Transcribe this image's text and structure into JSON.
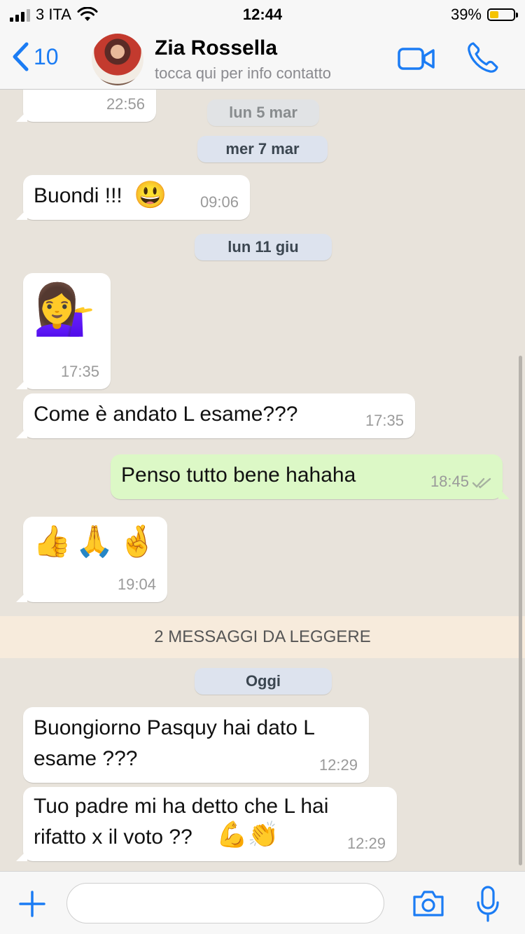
{
  "status_bar": {
    "carrier": "3 ITA",
    "time": "12:44",
    "battery": "39%",
    "battery_level": 0.39,
    "battery_color": "#f5c300"
  },
  "header": {
    "back_count": "10",
    "contact_name": "Zia Rossella",
    "contact_subtitle": "tocca qui per info contatto",
    "accent_color": "#1b7cf4",
    "icons": [
      "chevron-left-icon",
      "video-camera-icon",
      "phone-icon"
    ]
  },
  "chat": {
    "dates": {
      "lun5mar": "lun 5 mar",
      "mer7mar": "mer 7 mar",
      "lun11giu": "lun 11 giu",
      "oggi": "Oggi"
    },
    "messages": [
      {
        "direction": "in",
        "text": "",
        "time": "22:56"
      },
      {
        "direction": "in",
        "text": "Buondi !!!",
        "emoji": "😃",
        "time": "09:06"
      },
      {
        "direction": "in",
        "text": "",
        "emoji": "💁‍♀️",
        "time": "17:35"
      },
      {
        "direction": "in",
        "text": "Come è andato L esame???",
        "time": "17:35"
      },
      {
        "direction": "out",
        "text": "Penso tutto bene hahaha",
        "time": "18:45",
        "status": "read"
      },
      {
        "direction": "in",
        "text": "",
        "emoji": "👍🙏🤞",
        "time": "19:04"
      },
      {
        "direction": "in",
        "text_lines": [
          "Buongiorno Pasquy hai dato L",
          "esame ???"
        ],
        "time": "12:29"
      },
      {
        "direction": "in",
        "text_lines": [
          "Tuo padre mi ha detto che L hai",
          "rifatto x il voto ??"
        ],
        "emoji": "💪👏",
        "time": "12:29"
      }
    ],
    "unread_banner": "2 MESSAGGI DA LEGGERE",
    "bubble_in_color": "#ffffff",
    "bubble_out_color": "#dcf8c6"
  },
  "composer": {
    "placeholder": "",
    "icons": [
      "plus-icon",
      "camera-icon",
      "microphone-icon"
    ]
  }
}
